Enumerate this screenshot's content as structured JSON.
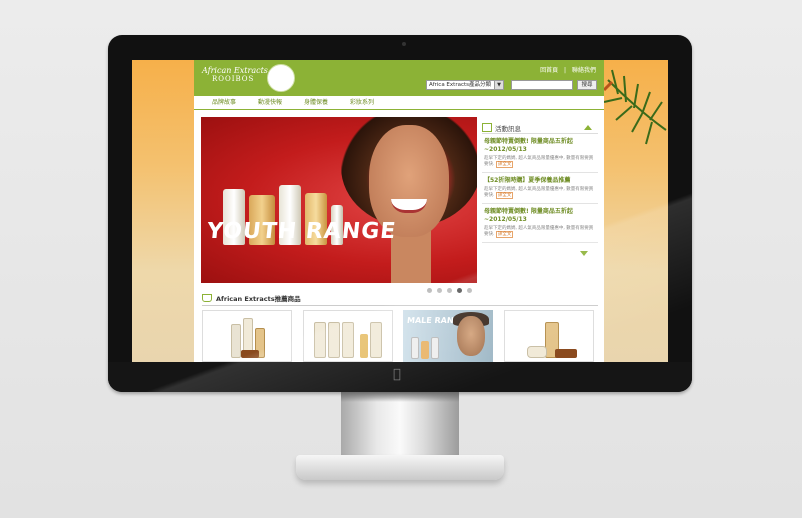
{
  "site": {
    "logo_script": "African Extracts",
    "logo_sub": "ROOIBOS",
    "top_links": [
      "回首頁",
      "|",
      "聯絡我們"
    ],
    "category_select": "Africa Extracts產品分類",
    "search_button": "搜尋"
  },
  "nav": [
    "品牌故事",
    "動漫快報",
    "身體保養",
    "彩妝系列"
  ],
  "hero": {
    "title": "YOUTH RANGE",
    "slide_count": 5,
    "active_slide": 4
  },
  "news": {
    "heading": "活動訊息",
    "items": [
      {
        "title": "母親節特賣倒數! 限量商品五折起~2012/05/13",
        "desc": "趁早下定的媽媽, 超人氣商品限量優惠中, 數量有限要買要快.",
        "more": "詳全文"
      },
      {
        "title": "【52折限時購】夏季保養品推薦",
        "desc": "趁早下定的媽媽, 超人氣商品限量優惠中, 數量有限要買要快.",
        "more": "詳全文"
      },
      {
        "title": "母親節特賣倒數! 限量商品五折起~2012/05/13",
        "desc": "趁早下定的媽媽, 超人氣商品限量優惠中, 數量有限要買要快.",
        "more": "詳全文"
      }
    ]
  },
  "recommend": {
    "heading": "African Extracts推薦商品",
    "male_banner": "MALE RANGE"
  },
  "colors": {
    "brand_green": "#8cb236",
    "hero_red": "#c31c1c",
    "link_orange": "#d4731f"
  },
  "icons": [
    "apple-logo-icon",
    "calendar-icon",
    "arrow-up-icon",
    "arrow-down-icon",
    "bag-icon"
  ]
}
